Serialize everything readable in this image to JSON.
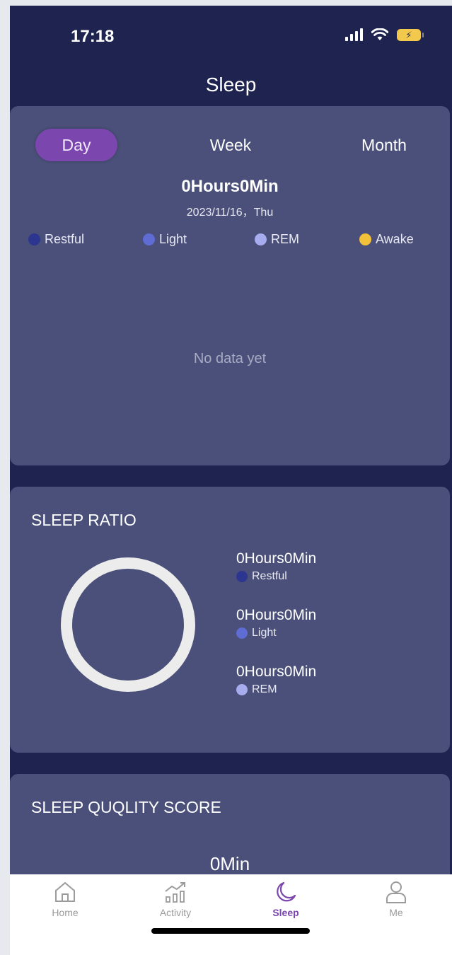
{
  "status_bar": {
    "time": "17:18"
  },
  "nav": {
    "title": "Sleep"
  },
  "period_tabs": {
    "day": "Day",
    "week": "Week",
    "month": "Month",
    "selected": "Day"
  },
  "summary": {
    "total": "0Hours0Min",
    "date": "2023/11/16，Thu"
  },
  "legend": [
    {
      "label": "Restful",
      "color": "#2c3590"
    },
    {
      "label": "Light",
      "color": "#5f6cd3"
    },
    {
      "label": "REM",
      "color": "#a6acee"
    },
    {
      "label": "Awake",
      "color": "#f2c13a"
    }
  ],
  "chart": {
    "empty_message": "No data yet"
  },
  "sleep_ratio": {
    "heading": "SLEEP RATIO",
    "items": [
      {
        "value": "0Hours0Min",
        "label": "Restful",
        "color": "#2c3590"
      },
      {
        "value": "0Hours0Min",
        "label": "Light",
        "color": "#5f6cd3"
      },
      {
        "value": "0Hours0Min",
        "label": "REM",
        "color": "#a6acee"
      }
    ]
  },
  "quality": {
    "heading": "SLEEP QUQLITY SCORE",
    "value": "0Min"
  },
  "tab_bar": [
    {
      "label": "Home",
      "icon": "home-icon"
    },
    {
      "label": "Activity",
      "icon": "activity-icon"
    },
    {
      "label": "Sleep",
      "icon": "moon-icon",
      "active": true
    },
    {
      "label": "Me",
      "icon": "user-icon"
    }
  ]
}
